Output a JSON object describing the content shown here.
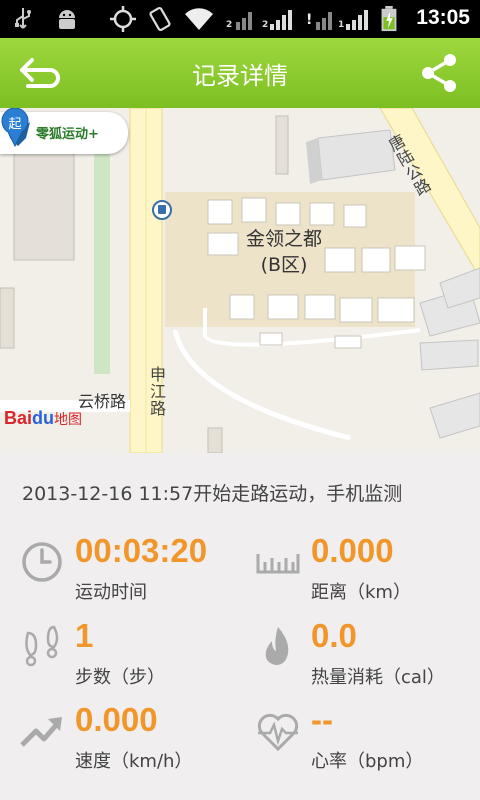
{
  "status_bar": {
    "time": "13:05",
    "sim_labels": [
      "2",
      "2",
      "1"
    ]
  },
  "header": {
    "title": "记录详情",
    "back_icon": "back-arrow-icon",
    "share_icon": "share-icon"
  },
  "map": {
    "app_logo_text": "零狐运动+",
    "roads": [
      "云桥路",
      "申江路",
      "唐陆公路"
    ],
    "place": "金领之都",
    "place_sub": "(B区)",
    "start_marker": "起",
    "baidu_brand": "Bai",
    "baidu_du": "du",
    "baidu_suffix": "地图"
  },
  "record": {
    "header": "2013-12-16 11:57开始走路运动，手机监测"
  },
  "stats": {
    "time": {
      "value": "00:03:20",
      "label": "运动时间",
      "icon": "clock-icon"
    },
    "distance": {
      "value": "0.000",
      "label": "距离（km）",
      "icon": "ruler-icon"
    },
    "steps": {
      "value": "1",
      "label": "步数（步）",
      "icon": "footprints-icon"
    },
    "calories": {
      "value": "0.0",
      "label": "热量消耗（cal）",
      "icon": "flame-icon"
    },
    "speed": {
      "value": "0.000",
      "label": "速度（km/h）",
      "icon": "trend-arrow-icon"
    },
    "heart_rate": {
      "value": "--",
      "label": "心率（bpm）",
      "icon": "heart-rate-icon"
    }
  },
  "colors": {
    "accent": "#7cbf22",
    "value": "#f0962a",
    "icon_gray": "#aaaaaa"
  }
}
